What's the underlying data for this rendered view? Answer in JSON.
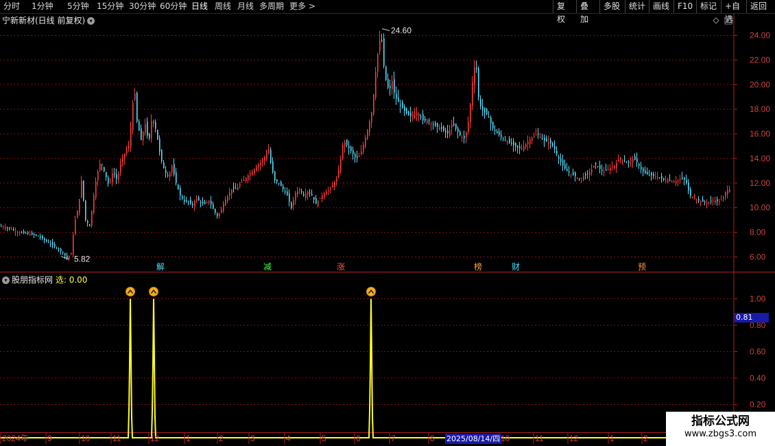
{
  "toolbar": {
    "periods": [
      {
        "label": "分时",
        "active": false
      },
      {
        "label": "1分钟",
        "active": false
      },
      {
        "label": "5分钟",
        "active": false
      },
      {
        "label": "15分钟",
        "active": false
      },
      {
        "label": "30分钟",
        "active": false
      },
      {
        "label": "60分钟",
        "active": false
      },
      {
        "label": "日线",
        "active": true
      },
      {
        "label": "周线",
        "active": false
      },
      {
        "label": "月线",
        "active": false
      },
      {
        "label": "多周期",
        "active": false
      },
      {
        "label": "更多 >",
        "active": false
      }
    ],
    "buttons": [
      "复权",
      "叠加",
      "多股",
      "统计",
      "画线",
      "F10",
      "标记",
      "+自选",
      "返回"
    ]
  },
  "main_chart": {
    "title": "宁新新材(日线 前复权)",
    "high_label": "24.60",
    "low_label": "5.82",
    "y_ticks": [
      "24.00",
      "22.00",
      "20.00",
      "18.00",
      "16.00",
      "14.00",
      "12.00",
      "10.00",
      "8.00",
      "6.00"
    ],
    "events": [
      {
        "label": "解",
        "color": "#40e0ff"
      },
      {
        "label": "减",
        "color": "#40ff40"
      },
      {
        "label": "涨",
        "color": "#ff5050"
      },
      {
        "label": "榜",
        "color": "#ffa040"
      },
      {
        "label": "财",
        "color": "#40e0ff"
      },
      {
        "label": "预",
        "color": "#ff9030"
      }
    ]
  },
  "indicator": {
    "name": "股朋指标网",
    "select_label": "选: 0.00",
    "current_value": "0.81",
    "y_ticks": [
      "1.00",
      "0.80",
      "0.60",
      "0.40",
      "0.20"
    ]
  },
  "x_axis": {
    "labels": [
      "2024年",
      "9",
      "10",
      "11",
      "12",
      "1",
      "2",
      "3",
      "4",
      "5",
      "6",
      "7",
      "8",
      "9",
      "10",
      "11",
      "12",
      "1",
      "2"
    ],
    "cursor_date": "2025/08/14/四"
  },
  "watermark": {
    "line1": "指标公式网",
    "line2": "www.zbgs3.com"
  },
  "chart_data": [
    {
      "type": "candlestick",
      "title": "宁新新材(日线 前复权)",
      "ylim": [
        5,
        25
      ],
      "grid": true,
      "close_path": [
        [
          0,
          8.5
        ],
        [
          14,
          8.3
        ],
        [
          25,
          8.0
        ],
        [
          40,
          7.9
        ],
        [
          55,
          7.7
        ],
        [
          66,
          7.3
        ],
        [
          78,
          6.9
        ],
        [
          90,
          6.4
        ],
        [
          97,
          5.9
        ],
        [
          103,
          6.3
        ],
        [
          108,
          8.8
        ],
        [
          114,
          10.2
        ],
        [
          118,
          12.2
        ],
        [
          124,
          9.0
        ],
        [
          130,
          8.5
        ],
        [
          136,
          11.0
        ],
        [
          140,
          12.5
        ],
        [
          146,
          13.8
        ],
        [
          152,
          12.8
        ],
        [
          158,
          11.8
        ],
        [
          164,
          13.0
        ],
        [
          170,
          12.2
        ],
        [
          176,
          13.8
        ],
        [
          182,
          14.5
        ],
        [
          187,
          15.0
        ],
        [
          191,
          17.0
        ],
        [
          195,
          20.0
        ],
        [
          199,
          17.0
        ],
        [
          205,
          15.5
        ],
        [
          211,
          16.8
        ],
        [
          216,
          15.2
        ],
        [
          221,
          17.5
        ],
        [
          227,
          16.2
        ],
        [
          233,
          14.2
        ],
        [
          239,
          13.0
        ],
        [
          245,
          12.5
        ],
        [
          250,
          13.4
        ],
        [
          256,
          12.0
        ],
        [
          262,
          11.0
        ],
        [
          268,
          10.5
        ],
        [
          274,
          10.5
        ],
        [
          280,
          10.2
        ],
        [
          286,
          10.8
        ],
        [
          292,
          10.4
        ],
        [
          298,
          10.3
        ],
        [
          304,
          10.6
        ],
        [
          310,
          9.9
        ],
        [
          316,
          9.3
        ],
        [
          320,
          9.6
        ],
        [
          326,
          10.5
        ],
        [
          332,
          11.0
        ],
        [
          338,
          11.6
        ],
        [
          344,
          11.5
        ],
        [
          350,
          12.0
        ],
        [
          356,
          12.3
        ],
        [
          362,
          12.7
        ],
        [
          368,
          13.0
        ],
        [
          374,
          13.4
        ],
        [
          380,
          13.7
        ],
        [
          386,
          14.2
        ],
        [
          391,
          14.7
        ],
        [
          395,
          13.3
        ],
        [
          400,
          12.2
        ],
        [
          406,
          12.0
        ],
        [
          412,
          11.5
        ],
        [
          418,
          11.0
        ],
        [
          424,
          10.0
        ],
        [
          430,
          11.2
        ],
        [
          436,
          11.5
        ],
        [
          442,
          11.0
        ],
        [
          448,
          11.3
        ],
        [
          454,
          11.0
        ],
        [
          460,
          10.3
        ],
        [
          466,
          10.8
        ],
        [
          472,
          11.2
        ],
        [
          478,
          11.4
        ],
        [
          484,
          11.8
        ],
        [
          490,
          12.3
        ],
        [
          495,
          13.5
        ],
        [
          500,
          15.5
        ],
        [
          506,
          15.0
        ],
        [
          512,
          14.5
        ],
        [
          518,
          14.0
        ],
        [
          524,
          14.2
        ],
        [
          530,
          15.3
        ],
        [
          536,
          16.5
        ],
        [
          542,
          18.0
        ],
        [
          547,
          21.0
        ],
        [
          551,
          23.0
        ],
        [
          555,
          24.2
        ],
        [
          559,
          21.5
        ],
        [
          563,
          20.0
        ],
        [
          567,
          19.5
        ],
        [
          571,
          20.3
        ],
        [
          575,
          19.0
        ],
        [
          581,
          18.5
        ],
        [
          587,
          18.0
        ],
        [
          593,
          17.6
        ],
        [
          599,
          17.4
        ],
        [
          605,
          17.7
        ],
        [
          611,
          17.6
        ],
        [
          617,
          17.0
        ],
        [
          623,
          17.2
        ],
        [
          629,
          16.8
        ],
        [
          635,
          16.6
        ],
        [
          641,
          16.5
        ],
        [
          647,
          16.2
        ],
        [
          653,
          16.0
        ],
        [
          659,
          16.9
        ],
        [
          665,
          16.3
        ],
        [
          671,
          15.8
        ],
        [
          677,
          15.6
        ],
        [
          683,
          17.2
        ],
        [
          689,
          20.8
        ],
        [
          693,
          22.0
        ],
        [
          697,
          19.0
        ],
        [
          701,
          18.0
        ],
        [
          705,
          17.8
        ],
        [
          711,
          17.5
        ],
        [
          717,
          16.5
        ],
        [
          723,
          16.1
        ],
        [
          729,
          15.8
        ],
        [
          735,
          15.5
        ],
        [
          741,
          15.3
        ],
        [
          747,
          15.1
        ],
        [
          753,
          14.9
        ],
        [
          759,
          14.8
        ],
        [
          765,
          15.1
        ],
        [
          771,
          15.5
        ],
        [
          777,
          15.8
        ],
        [
          783,
          16.0
        ],
        [
          789,
          15.6
        ],
        [
          795,
          15.4
        ],
        [
          801,
          15.3
        ],
        [
          807,
          14.9
        ],
        [
          813,
          14.1
        ],
        [
          819,
          13.5
        ],
        [
          825,
          13.0
        ],
        [
          831,
          12.8
        ],
        [
          837,
          12.6
        ],
        [
          843,
          12.3
        ],
        [
          849,
          12.5
        ],
        [
          855,
          12.7
        ],
        [
          861,
          13.0
        ],
        [
          867,
          13.6
        ],
        [
          873,
          13.2
        ],
        [
          879,
          12.9
        ],
        [
          885,
          13.1
        ],
        [
          891,
          13.3
        ],
        [
          897,
          13.5
        ],
        [
          903,
          14.1
        ],
        [
          909,
          13.8
        ],
        [
          915,
          13.6
        ],
        [
          921,
          14.0
        ],
        [
          927,
          13.8
        ],
        [
          933,
          13.2
        ],
        [
          939,
          12.8
        ],
        [
          945,
          12.7
        ],
        [
          951,
          12.6
        ],
        [
          957,
          12.5
        ],
        [
          963,
          12.4
        ],
        [
          969,
          12.2
        ],
        [
          975,
          12.3
        ],
        [
          981,
          12.1
        ],
        [
          987,
          12.2
        ],
        [
          993,
          12.4
        ],
        [
          999,
          12.2
        ],
        [
          1005,
          11.0
        ],
        [
          1011,
          10.8
        ],
        [
          1017,
          10.6
        ],
        [
          1023,
          10.5
        ],
        [
          1029,
          10.4
        ],
        [
          1035,
          10.5
        ],
        [
          1041,
          10.6
        ],
        [
          1047,
          10.5
        ],
        [
          1053,
          10.7
        ],
        [
          1058,
          11.4
        ],
        [
          1063,
          11.5
        ]
      ],
      "high": 24.6,
      "low": 5.82
    },
    {
      "type": "line",
      "title": "股朋指标网",
      "ylim": [
        0,
        1.2
      ],
      "series": [
        {
          "values": [
            0,
            0,
            0,
            1,
            0,
            1,
            0,
            1,
            0
          ]
        }
      ]
    }
  ]
}
